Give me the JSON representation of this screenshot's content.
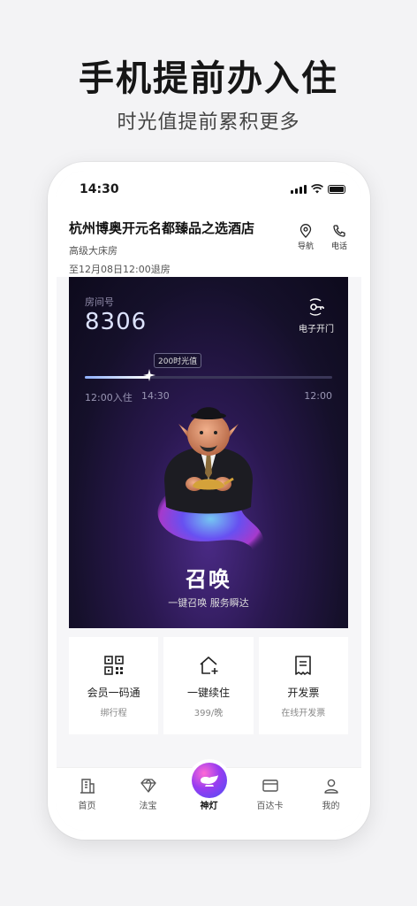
{
  "promo": {
    "title": "手机提前办入住",
    "subtitle": "时光值提前累积更多"
  },
  "status_bar": {
    "time": "14:30"
  },
  "hotel": {
    "name": "杭州博奥开元名都臻品之选酒店",
    "room_type": "高级大床房",
    "checkout": "至12月08日12:00退房",
    "actions": [
      {
        "label": "导航",
        "icon": "location-pin-icon"
      },
      {
        "label": "电话",
        "icon": "phone-icon"
      }
    ]
  },
  "room_card": {
    "room_label": "房间号",
    "room_number": "8306",
    "ekey_label": "电子开门",
    "ekey_icon": "nfc-key-icon",
    "time_value_badge": "200时光值",
    "timeline": {
      "start": "12:00入住",
      "current": "14:30",
      "end": "12:00",
      "progress": 0.26
    },
    "summon_title": "召唤",
    "summon_subtitle": "一键召唤 服务瞬达"
  },
  "quick_actions": [
    {
      "title": "会员一码通",
      "sub": "绑行程",
      "icon": "qr-code-icon"
    },
    {
      "title": "一键续住",
      "sub": "399/晚",
      "icon": "house-plus-icon"
    },
    {
      "title": "开发票",
      "sub": "在线开发票",
      "icon": "receipt-icon"
    }
  ],
  "tabbar": [
    {
      "label": "首页",
      "icon": "building-icon"
    },
    {
      "label": "法宝",
      "icon": "diamond-icon"
    },
    {
      "label": "神灯",
      "icon": "magic-lamp-icon",
      "active": true
    },
    {
      "label": "百达卡",
      "icon": "card-icon"
    },
    {
      "label": "我的",
      "icon": "user-icon"
    }
  ],
  "colors": {
    "card_bg": "#15102a",
    "lamp_gradient_start": "#ff6ad5",
    "lamp_gradient_end": "#4a4ff5"
  }
}
